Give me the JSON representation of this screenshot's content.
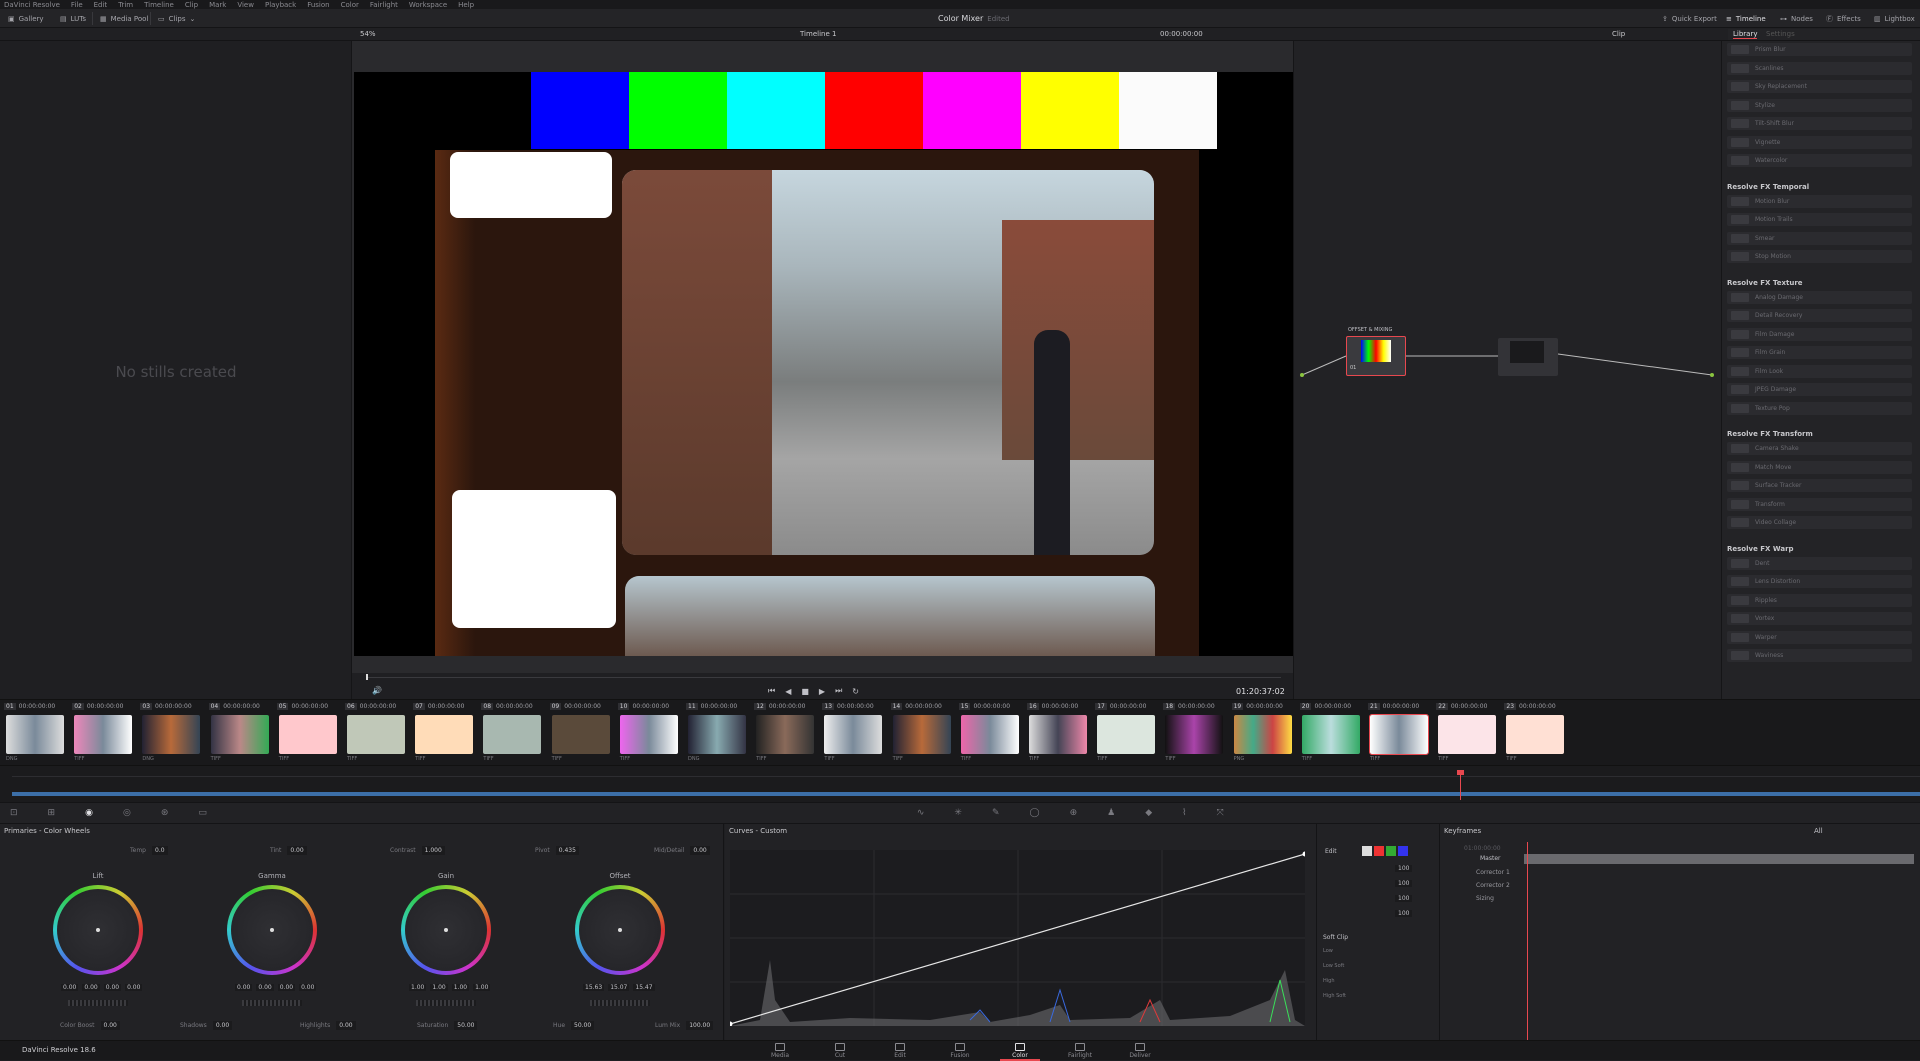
{
  "menubar": {
    "items": [
      "DaVinci Resolve",
      "File",
      "Edit",
      "Trim",
      "Timeline",
      "Clip",
      "Mark",
      "View",
      "Playback",
      "Fusion",
      "Color",
      "Fairlight",
      "Workspace",
      "Help"
    ]
  },
  "toolbar": {
    "gallery": "Gallery",
    "luts": "LUTs",
    "media_pool": "Media Pool",
    "clips": "Clips",
    "project_title": "Color Mixer",
    "status": "Edited",
    "quick_export": "Quick Export",
    "timeline": "Timeline",
    "nodes": "Nodes",
    "effects": "Effects",
    "lightbox": "Lightbox"
  },
  "viewer": {
    "zoom": "54%",
    "timeline_name": "Timeline 1",
    "timecode_top": "00:00:00:00",
    "clip_mode": "Clip",
    "timecode": "01:20:37:02"
  },
  "gallery": {
    "empty_text": "No stills created"
  },
  "nodes": {
    "node1_label": "OFFSET & MIXING",
    "node1_num": "01"
  },
  "library": {
    "tabs": [
      "Library",
      "Settings"
    ],
    "groups": [
      {
        "title": "",
        "items": [
          "Prism Blur",
          "Scanlines",
          "Sky Replacement",
          "Stylize",
          "Tilt-Shift Blur",
          "Vignette",
          "Watercolor"
        ]
      },
      {
        "title": "Resolve FX Temporal",
        "items": [
          "Motion Blur",
          "Motion Trails",
          "Smear",
          "Stop Motion"
        ]
      },
      {
        "title": "Resolve FX Texture",
        "items": [
          "Analog Damage",
          "Detail Recovery",
          "Film Damage",
          "Film Grain",
          "Film Look",
          "JPEG Damage",
          "Texture Pop"
        ]
      },
      {
        "title": "Resolve FX Transform",
        "items": [
          "Camera Shake",
          "Match Move",
          "Surface Tracker",
          "Transform",
          "Video Collage"
        ]
      },
      {
        "title": "Resolve FX Warp",
        "items": [
          "Dent",
          "Lens Distortion",
          "Ripples",
          "Vortex",
          "Warper",
          "Waviness"
        ]
      }
    ]
  },
  "clips": [
    {
      "n": "01",
      "tc": "00:00:00:00",
      "fmt": "DNG"
    },
    {
      "n": "02",
      "tc": "00:00:00:00",
      "fmt": "TIFF"
    },
    {
      "n": "03",
      "tc": "00:00:00:00",
      "fmt": "DNG"
    },
    {
      "n": "04",
      "tc": "00:00:00:00",
      "fmt": "TIFF"
    },
    {
      "n": "05",
      "tc": "00:00:00:00",
      "fmt": "TIFF"
    },
    {
      "n": "06",
      "tc": "00:00:00:00",
      "fmt": "TIFF"
    },
    {
      "n": "07",
      "tc": "00:00:00:00",
      "fmt": "TIFF"
    },
    {
      "n": "08",
      "tc": "00:00:00:00",
      "fmt": "TIFF"
    },
    {
      "n": "09",
      "tc": "00:00:00:00",
      "fmt": "TIFF"
    },
    {
      "n": "10",
      "tc": "00:00:00:00",
      "fmt": "TIFF"
    },
    {
      "n": "11",
      "tc": "00:00:00:00",
      "fmt": "DNG"
    },
    {
      "n": "12",
      "tc": "00:00:00:00",
      "fmt": "TIFF"
    },
    {
      "n": "13",
      "tc": "00:00:00:00",
      "fmt": "TIFF"
    },
    {
      "n": "14",
      "tc": "00:00:00:00",
      "fmt": "TIFF"
    },
    {
      "n": "15",
      "tc": "00:00:00:00",
      "fmt": "TIFF"
    },
    {
      "n": "16",
      "tc": "00:00:00:00",
      "fmt": "TIFF"
    },
    {
      "n": "17",
      "tc": "00:00:00:00",
      "fmt": "TIFF"
    },
    {
      "n": "18",
      "tc": "00:00:00:00",
      "fmt": "TIFF"
    },
    {
      "n": "19",
      "tc": "00:00:00:00",
      "fmt": "PNG"
    },
    {
      "n": "20",
      "tc": "00:00:00:00",
      "fmt": "TIFF"
    },
    {
      "n": "21",
      "tc": "00:00:00:00",
      "fmt": "TIFF"
    },
    {
      "n": "22",
      "tc": "00:00:00:00",
      "fmt": "TIFF"
    },
    {
      "n": "23",
      "tc": "00:00:00:00",
      "fmt": "TIFF"
    }
  ],
  "primaries": {
    "title": "Primaries - Color Wheels",
    "top_params": [
      {
        "label": "Temp",
        "value": "0.0"
      },
      {
        "label": "Tint",
        "value": "0.00"
      },
      {
        "label": "Contrast",
        "value": "1.000"
      },
      {
        "label": "Pivot",
        "value": "0.435"
      },
      {
        "label": "Mid/Detail",
        "value": "0.00"
      }
    ],
    "wheels": [
      {
        "name": "Lift",
        "values": [
          "0.00",
          "0.00",
          "0.00",
          "0.00"
        ]
      },
      {
        "name": "Gamma",
        "values": [
          "0.00",
          "0.00",
          "0.00",
          "0.00"
        ]
      },
      {
        "name": "Gain",
        "values": [
          "1.00",
          "1.00",
          "1.00",
          "1.00"
        ]
      },
      {
        "name": "Offset",
        "values": [
          "15.63",
          "15.07",
          "15.47"
        ]
      }
    ],
    "bottom_params": [
      {
        "label": "Color Boost",
        "value": "0.00"
      },
      {
        "label": "Shadows",
        "value": "0.00"
      },
      {
        "label": "Highlights",
        "value": "0.00"
      },
      {
        "label": "Saturation",
        "value": "50.00"
      },
      {
        "label": "Hue",
        "value": "50.00"
      },
      {
        "label": "Lum Mix",
        "value": "100.00"
      }
    ]
  },
  "curves": {
    "title": "Curves - Custom",
    "edit": "Edit",
    "values": [
      "100",
      "100",
      "100",
      "100"
    ],
    "soft_clip": "Soft Clip",
    "soft_labels": [
      "Low",
      "Low Soft",
      "High",
      "High Soft"
    ]
  },
  "keyframes": {
    "title": "Keyframes",
    "filter": "All",
    "timecode": "01:00:00:00",
    "tracks": [
      "Master",
      "Corrector 1",
      "Corrector 2",
      "Sizing"
    ]
  },
  "footer": {
    "app": "DaVinci Resolve 18.6",
    "pages": [
      "Media",
      "Cut",
      "Edit",
      "Fusion",
      "Color",
      "Fairlight",
      "Deliver"
    ],
    "active": "Color"
  },
  "colors": {
    "accent": "#e8484f",
    "active_page": "#e8484f",
    "timeline_blue": "#3c6fa8"
  }
}
